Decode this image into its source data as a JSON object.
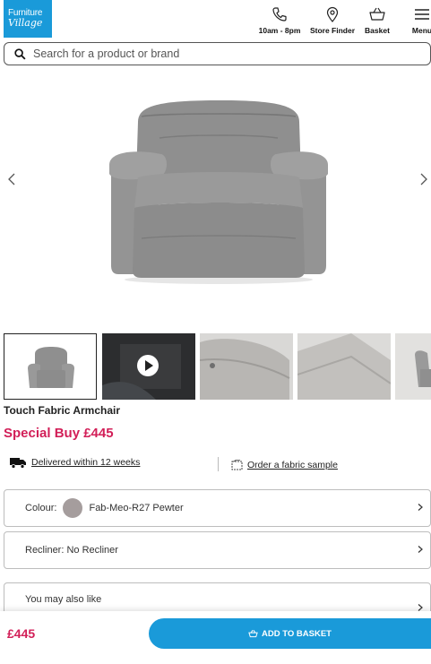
{
  "header": {
    "logo_line1": "Furniture",
    "logo_line2": "Village",
    "hours_label": "10am - 8pm",
    "store_finder_label": "Store Finder",
    "basket_label": "Basket",
    "menu_label": "Menu"
  },
  "search": {
    "placeholder": "Search for a product or brand"
  },
  "product": {
    "title": "Touch Fabric Armchair",
    "price": "Special Buy £445",
    "delivery": "Delivered within 12 weeks",
    "sample": "Order a fabric sample"
  },
  "options": {
    "colour_label": "Colour:",
    "colour_value": "Fab-Meo-R27 Pewter",
    "recliner": "Recliner: No Recliner",
    "also_like": "You may also like"
  },
  "footer": {
    "price": "£445",
    "add_to_basket": "ADD TO BASKET"
  },
  "colors": {
    "brand_blue": "#1a9ad9",
    "price_pink": "#d21f58",
    "swatch": "#a59d9d"
  },
  "icons": [
    "phone-icon",
    "location-pin-icon",
    "basket-icon",
    "hamburger-menu-icon",
    "search-icon",
    "chevron-left-icon",
    "chevron-right-icon",
    "play-icon",
    "delivery-truck-icon",
    "fabric-sample-icon"
  ]
}
